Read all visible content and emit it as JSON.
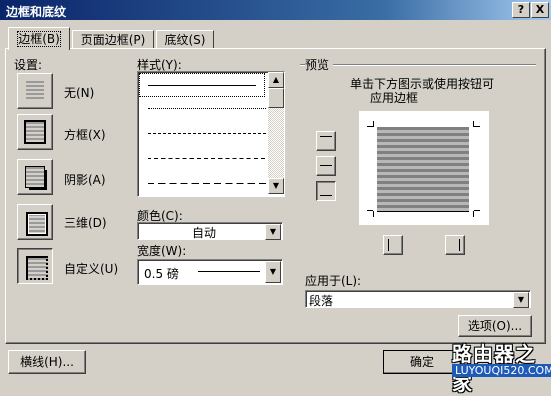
{
  "window": {
    "title": "边框和底纹",
    "help_btn": "?",
    "close_btn": "X"
  },
  "tabs": [
    {
      "label": "边框(B)"
    },
    {
      "label": "页面边框(P)"
    },
    {
      "label": "底纹(S)"
    }
  ],
  "settings": {
    "heading": "设置:",
    "items": [
      {
        "label": "无(N)",
        "icon": "border-none-icon",
        "selected": false
      },
      {
        "label": "方框(X)",
        "icon": "border-box-icon",
        "selected": false
      },
      {
        "label": "阴影(A)",
        "icon": "border-shadow-icon",
        "selected": false
      },
      {
        "label": "三维(D)",
        "icon": "border-3d-icon",
        "selected": false
      },
      {
        "label": "自定义(U)",
        "icon": "border-custom-icon",
        "selected": true
      }
    ]
  },
  "style": {
    "heading": "样式(Y):",
    "line_styles": [
      "solid",
      "dotted",
      "dash-dot",
      "dashed",
      "long-dashed"
    ]
  },
  "color": {
    "label": "颜色(C):",
    "value": "自动"
  },
  "width": {
    "label": "宽度(W):",
    "value": "0.5 磅"
  },
  "preview": {
    "heading": "预览",
    "instructions_line1": "单击下方图示或使用按钮可",
    "instructions_line2": "应用边框"
  },
  "apply_to": {
    "label": "应用于(L):",
    "value": "段落"
  },
  "buttons": {
    "options": "选项(O)...",
    "horizontal_line": "横线(H)...",
    "ok": "确定"
  },
  "watermark": {
    "logo_text": "路由器之家",
    "url_text": "LUYOUQI520.COM"
  },
  "colors": {
    "title_bar": "#0a246a",
    "dialog_bg": "#d4d0c8"
  }
}
